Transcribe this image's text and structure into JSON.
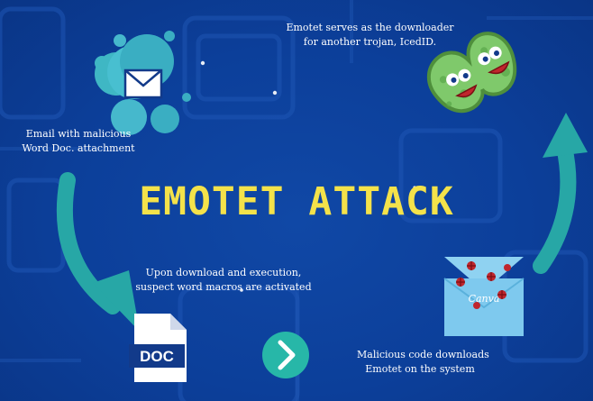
{
  "title": "EMOTET ATTACK",
  "steps": [
    {
      "id": "email",
      "label_lines": [
        "Email with malicious",
        "Word Doc. attachment"
      ]
    },
    {
      "id": "macro",
      "label_lines": [
        "Upon download and execution,",
        "suspect word macros are activated"
      ]
    },
    {
      "id": "download",
      "label_lines": [
        "Malicious code downloads",
        "Emotet on the system"
      ]
    },
    {
      "id": "trojan",
      "label_lines": [
        "Emotet serves as the downloader",
        "for another trojan, IcedID."
      ]
    }
  ],
  "doc_icon_label": "DOC",
  "envelope_watermark": "Canva",
  "colors": {
    "background": "#0c3f9a",
    "title": "#f4e24a",
    "arrow": "#27a7a6",
    "teal": "#3fb7c4",
    "envelope": "#7ec9ee",
    "bacteria": "#7fc96b"
  },
  "icons": [
    "mail-icon",
    "doc-file-icon",
    "chevron-right-icon",
    "infected-envelope-icon",
    "bacteria-icon"
  ]
}
